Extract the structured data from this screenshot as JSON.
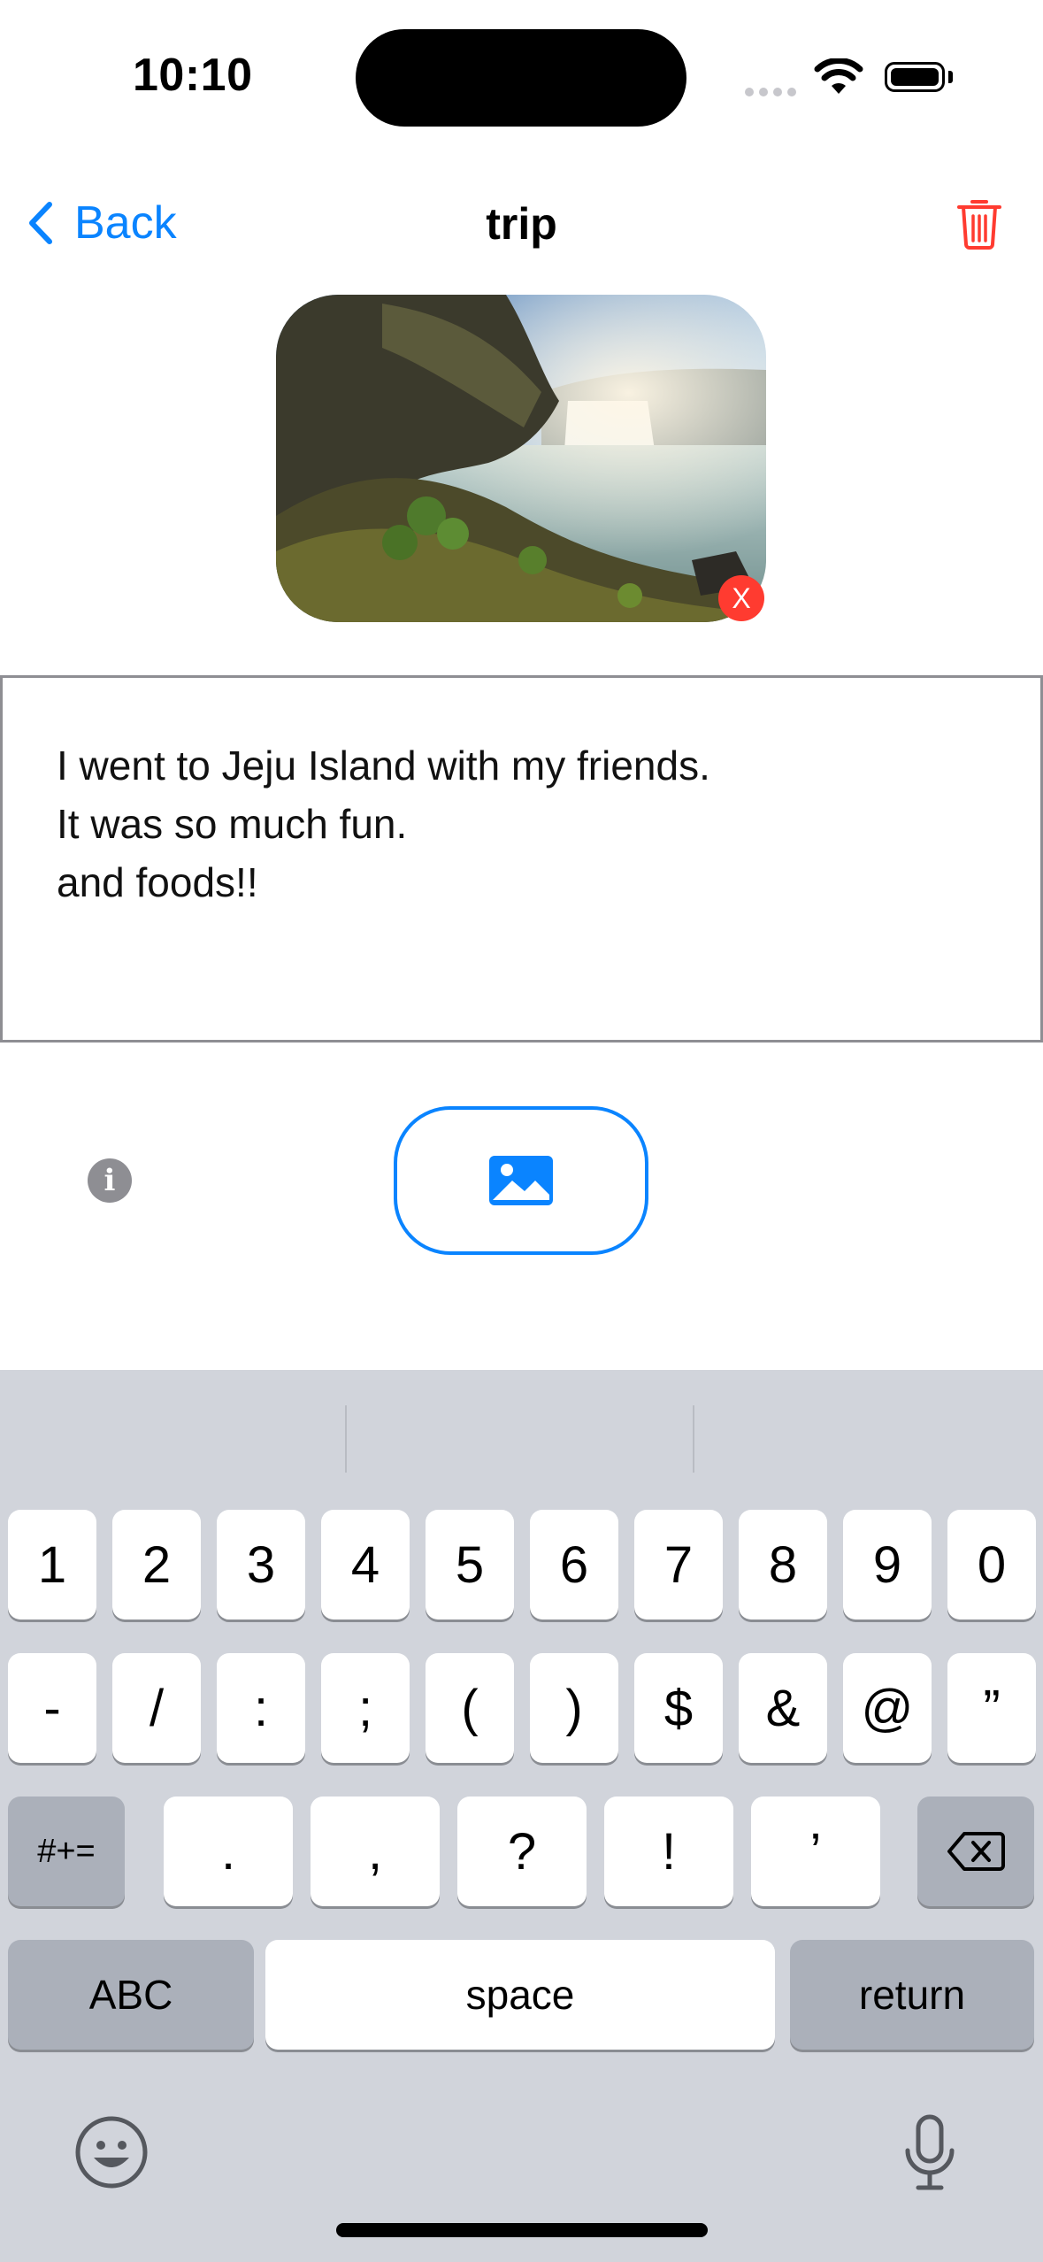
{
  "status_bar": {
    "time": "10:10"
  },
  "nav": {
    "back_label": "Back",
    "title": "trip",
    "delete_icon": "trash-icon"
  },
  "photo": {
    "remove_label": "X"
  },
  "note": {
    "lines": [
      "I went to Jeju Island with my friends.",
      "It was so much fun.",
      "and foods!!"
    ]
  },
  "toolbar": {
    "info_label": "i",
    "image_icon": "photo-icon"
  },
  "keyboard": {
    "row1": [
      "1",
      "2",
      "3",
      "4",
      "5",
      "6",
      "7",
      "8",
      "9",
      "0"
    ],
    "row2": [
      "-",
      "/",
      ":",
      ";",
      "(",
      ")",
      "$",
      "&",
      "@",
      "”"
    ],
    "row3": {
      "symbols_key": "#+=",
      "keys": [
        ".",
        ",",
        "?",
        "!",
        "’"
      ]
    },
    "row4": {
      "abc": "ABC",
      "space": "space",
      "return": "return"
    }
  },
  "colors": {
    "accent": "#0a84ff",
    "destructive": "#ff3b30",
    "keyboard_bg": "#d1d4db"
  }
}
